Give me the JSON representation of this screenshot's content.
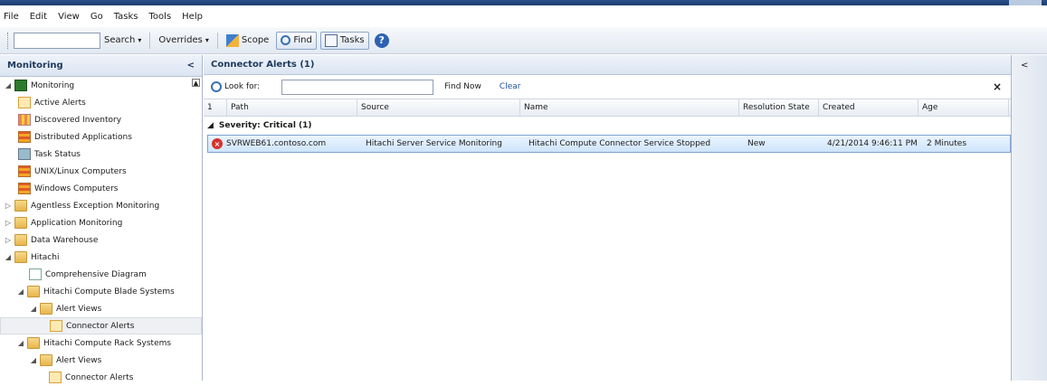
{
  "menu": [
    "File",
    "Edit",
    "View",
    "Go",
    "Tasks",
    "Tools",
    "Help"
  ],
  "toolbar": {
    "search_label": "Search",
    "overrides_label": "Overrides",
    "scope_label": "Scope",
    "find_label": "Find",
    "tasks_label": "Tasks",
    "help_label": "?"
  },
  "left_pane": {
    "title": "Monitoring",
    "collapse_glyph": "<",
    "items": [
      {
        "label": "Monitoring",
        "twisty": "◢",
        "icon": "monitor-icon"
      },
      {
        "label": "Active Alerts",
        "icon": "alert-view-icon"
      },
      {
        "label": "Discovered Inventory",
        "icon": "inventory-icon"
      },
      {
        "label": "Distributed Applications",
        "icon": "grid-icon"
      },
      {
        "label": "Task Status",
        "icon": "task-icon"
      },
      {
        "label": "UNIX/Linux Computers",
        "icon": "grid-icon"
      },
      {
        "label": "Windows Computers",
        "icon": "grid-icon"
      },
      {
        "label": "Agentless Exception Monitoring",
        "twisty": "▷",
        "icon": "folder-icon"
      },
      {
        "label": "Application Monitoring",
        "twisty": "▷",
        "icon": "folder-icon"
      },
      {
        "label": "Data Warehouse",
        "twisty": "▷",
        "icon": "folder-icon"
      },
      {
        "label": "Hitachi",
        "twisty": "◢",
        "icon": "folder-icon"
      },
      {
        "label": "Comprehensive Diagram",
        "icon": "diagram-icon"
      },
      {
        "label": "Hitachi Compute Blade Systems",
        "twisty": "◢",
        "icon": "folder-icon"
      },
      {
        "label": "Alert Views",
        "twisty": "◢",
        "icon": "folder-icon"
      },
      {
        "label": "Connector Alerts",
        "icon": "alert-view-icon"
      },
      {
        "label": "Hitachi Compute Rack Systems",
        "twisty": "◢",
        "icon": "folder-icon"
      },
      {
        "label": "Alert Views",
        "twisty": "◢",
        "icon": "folder-icon"
      },
      {
        "label": "Connector Alerts",
        "icon": "alert-view-icon"
      }
    ]
  },
  "main": {
    "title": "Connector Alerts (1)",
    "look_for_label": "Look for:",
    "search_value": "",
    "find_now_label": "Find Now",
    "clear_label": "Clear",
    "close_glyph": "×",
    "columns": [
      "1",
      "Path",
      "Source",
      "Name",
      "Resolution State",
      "Created",
      "Age"
    ],
    "group_label": "Severity: Critical (1)",
    "rows": [
      {
        "path": "SVRWEB61.contoso.com",
        "source": "Hitachi Server Service Monitoring",
        "name": "Hitachi Compute Connector Service Stopped",
        "resolution_state": "New",
        "created": "4/21/2014 9:46:11 PM",
        "age": "2 Minutes"
      }
    ]
  },
  "right_pane": {
    "collapse_glyph": "<"
  }
}
